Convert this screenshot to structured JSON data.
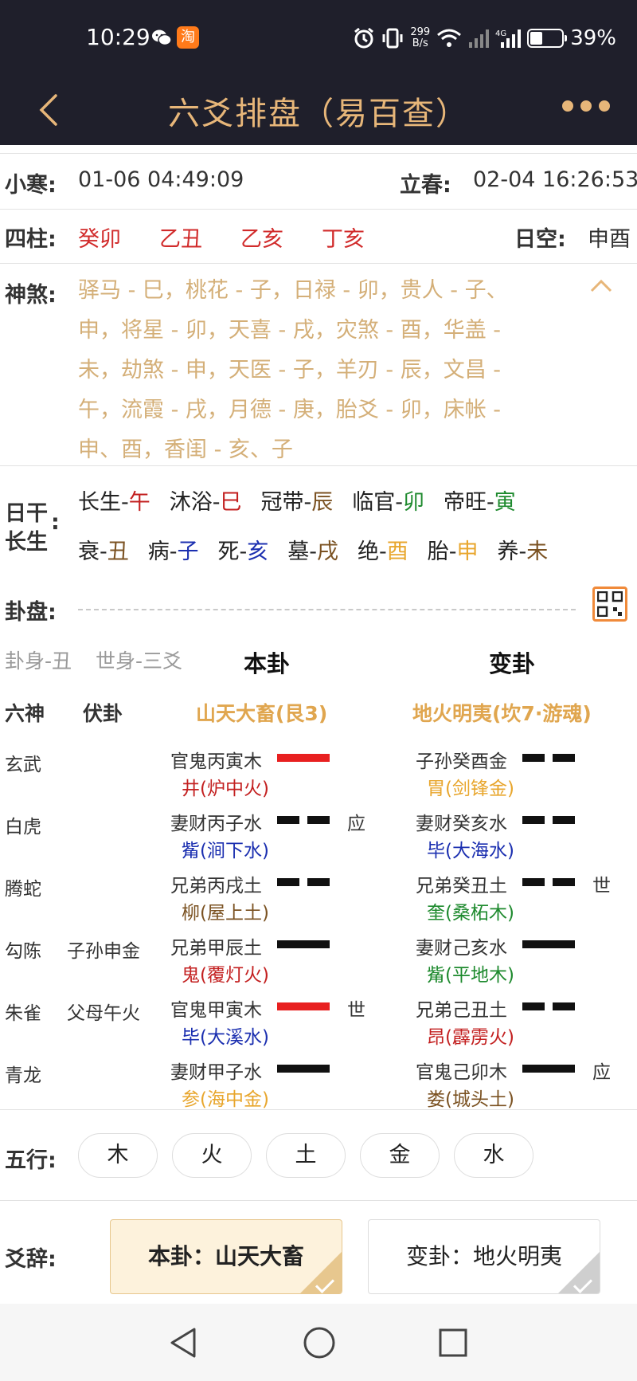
{
  "status": {
    "time": "10:29",
    "net_speed_top": "299",
    "net_speed_bottom": "B/s",
    "battery": "39%",
    "battery_level": 0.39,
    "taobao_glyph": "淘"
  },
  "nav": {
    "title": "六爻排盘（易百查）"
  },
  "jieqi": {
    "label1": "小寒:",
    "value1": "01-06 04:49:09",
    "label2": "立春:",
    "value2": "02-04 16:26:53"
  },
  "sizhu": {
    "label": "四柱:",
    "pillars": [
      "癸卯",
      "乙丑",
      "乙亥",
      "丁亥"
    ],
    "kong_label": "日空:",
    "kong_value": "申酉"
  },
  "shensha": {
    "label": "神煞:",
    "lines": [
      "驿马 - 巳，桃花 - 子，日禄 - 卯，贵人 - 子、",
      "申，将星 - 卯，天喜 - 戌，灾煞 - 酉，华盖 -",
      "未，劫煞 - 申，天医 - 子，羊刃 - 辰，文昌 -",
      "午，流霞 - 戌，月德 - 庚，胎爻 - 卯，床帐 -",
      "申、酉，香闺 - 亥、子"
    ]
  },
  "changsheng": {
    "label_line1": "日干",
    "label_line2": "长生",
    "colon": ":",
    "row1": [
      {
        "stage": "长生-",
        "branch": "午"
      },
      {
        "stage": "沐浴-",
        "branch": "巳"
      },
      {
        "stage": "冠带-",
        "branch": "辰"
      },
      {
        "stage": "临官-",
        "branch": "卯"
      },
      {
        "stage": "帝旺-",
        "branch": "寅"
      }
    ],
    "row2": [
      {
        "stage": "衰-",
        "branch": "丑"
      },
      {
        "stage": "病-",
        "branch": "子"
      },
      {
        "stage": "死-",
        "branch": "亥"
      },
      {
        "stage": "墓-",
        "branch": "戌"
      },
      {
        "stage": "绝-",
        "branch": "酉"
      },
      {
        "stage": "胎-",
        "branch": "申"
      },
      {
        "stage": "养-",
        "branch": "未"
      }
    ]
  },
  "guapan": {
    "label": "卦盘:",
    "guashen": "卦身-丑",
    "shishen": "世身-三爻",
    "ben_header": "本卦",
    "bian_header": "变卦",
    "col_liushen": "六神",
    "col_fugua": "伏卦",
    "ben_name": "山天大畜(艮3)",
    "bian_name": "地火明夷(坎7·游魂)",
    "rows": [
      {
        "liushen": "玄武",
        "fu": "",
        "ben": "官鬼丙寅木",
        "ben_xiu": "井(炉中火)",
        "ben_yao": "yang",
        "ben_moving": true,
        "ben_mark": "",
        "bian": "子孙癸酉金",
        "bian_xiu": "胃(剑锋金)",
        "bian_yao": "yin",
        "bian_mark": ""
      },
      {
        "liushen": "白虎",
        "fu": "",
        "ben": "妻财丙子水",
        "ben_xiu": "觜(涧下水)",
        "ben_yao": "yin",
        "ben_moving": false,
        "ben_mark": "应",
        "bian": "妻财癸亥水",
        "bian_xiu": "毕(大海水)",
        "bian_yao": "yin",
        "bian_mark": ""
      },
      {
        "liushen": "腾蛇",
        "fu": "",
        "ben": "兄弟丙戌土",
        "ben_xiu": "柳(屋上土)",
        "ben_yao": "yin",
        "ben_moving": false,
        "ben_mark": "",
        "bian": "兄弟癸丑土",
        "bian_xiu": "奎(桑柘木)",
        "bian_yao": "yin",
        "bian_mark": "世"
      },
      {
        "liushen": "勾陈",
        "fu": "子孙申金",
        "ben": "兄弟甲辰土",
        "ben_xiu": "鬼(覆灯火)",
        "ben_yao": "yang",
        "ben_moving": false,
        "ben_mark": "",
        "bian": "妻财己亥水",
        "bian_xiu": "觜(平地木)",
        "bian_yao": "yang",
        "bian_mark": ""
      },
      {
        "liushen": "朱雀",
        "fu": "父母午火",
        "ben": "官鬼甲寅木",
        "ben_xiu": "毕(大溪水)",
        "ben_yao": "yang",
        "ben_moving": true,
        "ben_mark": "世",
        "bian": "兄弟己丑土",
        "bian_xiu": "昂(霹雳火)",
        "bian_yao": "yin",
        "bian_mark": ""
      },
      {
        "liushen": "青龙",
        "fu": "",
        "ben": "妻财甲子水",
        "ben_xiu": "参(海中金)",
        "ben_yao": "yang",
        "ben_moving": false,
        "ben_mark": "",
        "bian": "官鬼己卯木",
        "bian_xiu": "娄(城头土)",
        "bian_yao": "yang",
        "bian_mark": "应"
      }
    ]
  },
  "wuxing": {
    "label": "五行:",
    "items": [
      "木",
      "火",
      "土",
      "金",
      "水"
    ]
  },
  "yaoci": {
    "label": "爻辞:",
    "ben": "本卦：山天大畜",
    "bian": "变卦：地火明夷"
  },
  "colors": {
    "navbar_bg": "#1f1f2b",
    "title_gold": "#e7b679",
    "pillar_red": "#d12b2b",
    "shensha_tan": "#d4af78",
    "moving_yao_red": "#e82020"
  }
}
